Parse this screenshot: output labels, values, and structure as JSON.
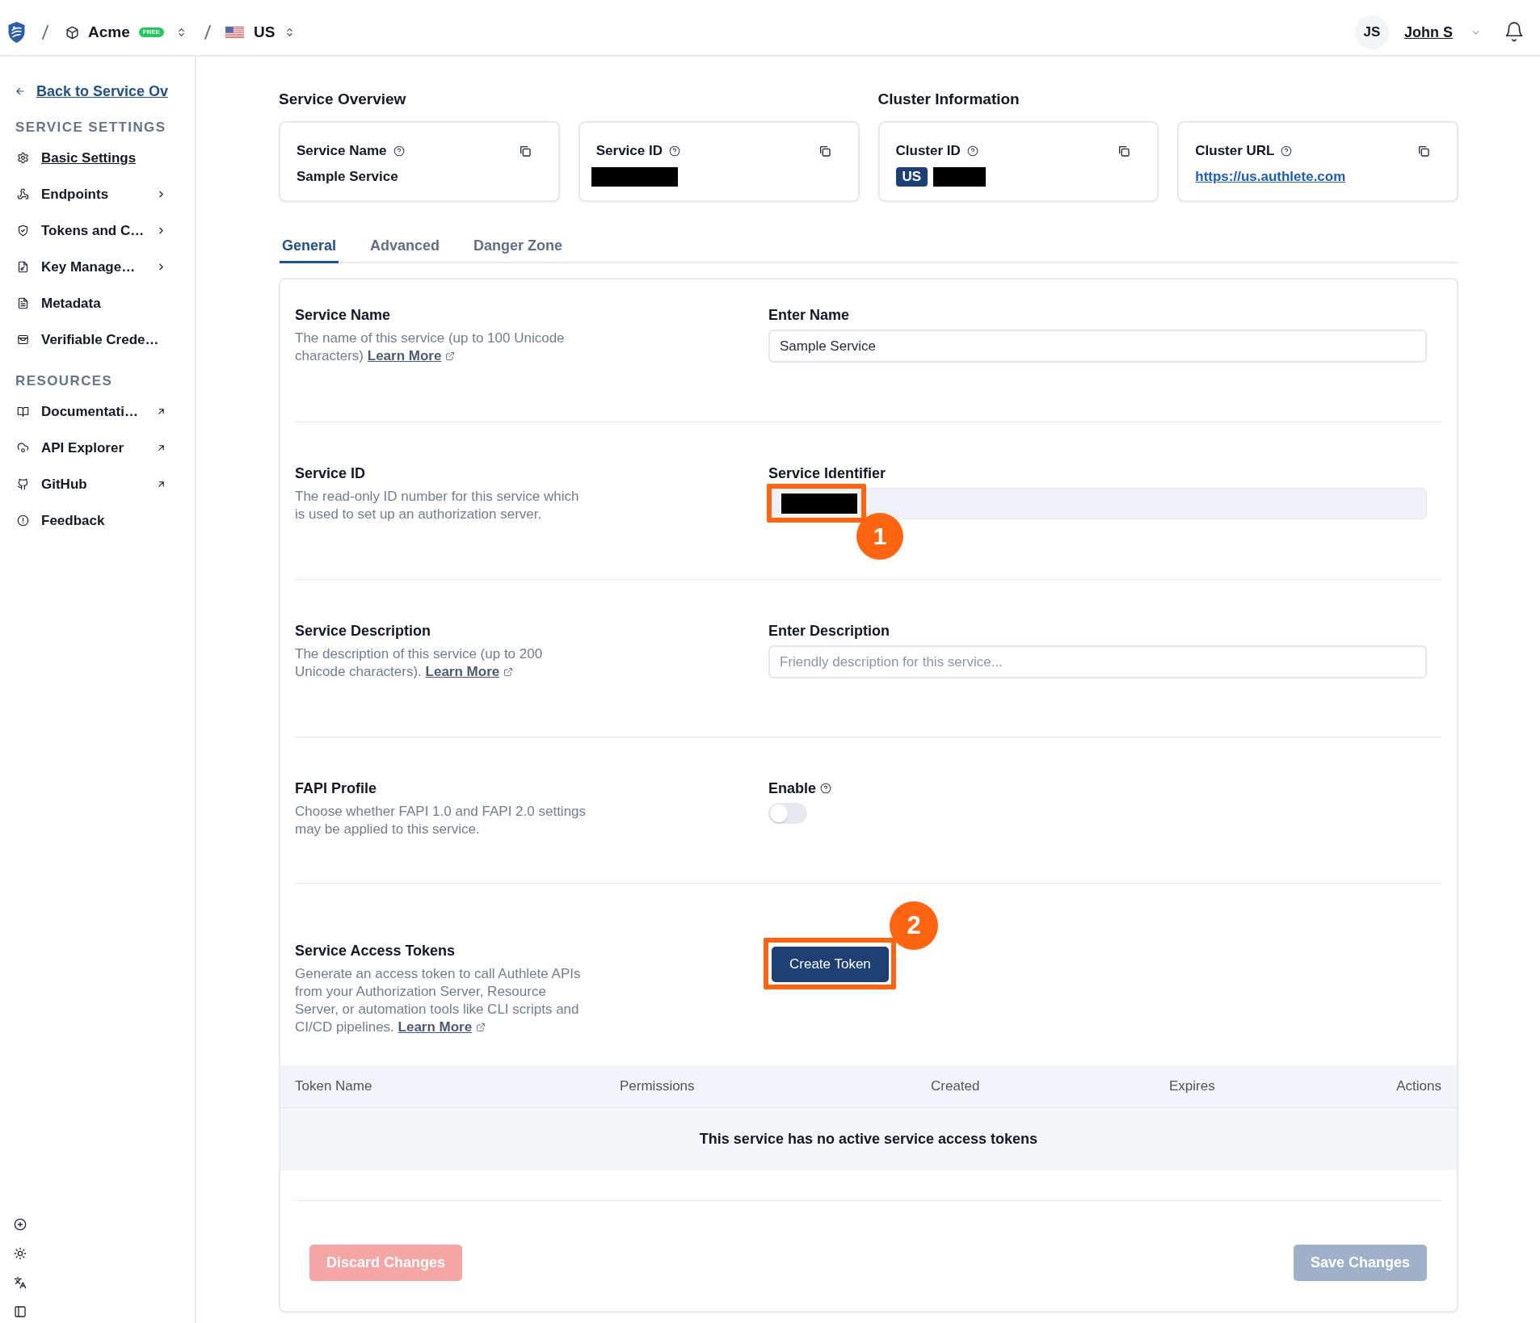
{
  "topbar": {
    "organization": "Acme",
    "plan_badge": "FREE",
    "cluster": "US",
    "user": {
      "initials": "JS",
      "name": "John S"
    }
  },
  "sidebar": {
    "back_link": "Back to Service Ov",
    "groups": [
      {
        "heading": "SERVICE SETTINGS",
        "items": [
          {
            "label": "Basic Settings",
            "kind": "page",
            "selected": true
          },
          {
            "label": "Endpoints",
            "kind": "submenu",
            "selected": false
          },
          {
            "label": "Tokens and C…",
            "kind": "submenu",
            "selected": false
          },
          {
            "label": "Key Manage…",
            "kind": "submenu",
            "selected": false
          },
          {
            "label": "Metadata",
            "kind": "page",
            "selected": false
          },
          {
            "label": "Verifiable Crede…",
            "kind": "page",
            "selected": false
          }
        ]
      },
      {
        "heading": "RESOURCES",
        "items": [
          {
            "label": "Documentati…",
            "kind": "external",
            "selected": false
          },
          {
            "label": "API Explorer",
            "kind": "external",
            "selected": false
          },
          {
            "label": "GitHub",
            "kind": "external",
            "selected": false
          },
          {
            "label": "Feedback",
            "kind": "page",
            "selected": false
          }
        ]
      }
    ]
  },
  "overview": [
    {
      "heading": "Service Overview",
      "cards": [
        {
          "label": "Service Name",
          "value": "Sample Service"
        },
        {
          "label": "Service ID",
          "redacted": true
        }
      ]
    },
    {
      "heading": "Cluster Information",
      "cards": [
        {
          "label": "Cluster ID",
          "badge": "US",
          "redacted": true
        },
        {
          "label": "Cluster URL",
          "link": "https://us.authlete.com"
        }
      ]
    }
  ],
  "tabs": [
    {
      "label": "General",
      "selected": true
    },
    {
      "label": "Advanced",
      "selected": false
    },
    {
      "label": "Danger Zone",
      "selected": false
    }
  ],
  "form": {
    "sections": [
      {
        "kind": "text_input",
        "title": "Service Name",
        "description": "The name of this service (up to 100 Unicode characters)",
        "link": "Learn More",
        "field_label": "Enter Name",
        "value": "Sample Service"
      },
      {
        "kind": "readonly",
        "title": "Service ID",
        "description": "The read-only ID number for this service which is used to set up an authorization server.",
        "field_label": "Service Identifier",
        "redacted": true,
        "callout": "1"
      },
      {
        "kind": "text_input",
        "title": "Service Description",
        "description": "The description of this service (up to 200 Unicode characters).",
        "link": "Learn More",
        "field_label": "Enter Description",
        "placeholder": "Friendly description for this service..."
      },
      {
        "kind": "toggle",
        "title": "FAPI Profile",
        "description": "Choose whether FAPI 1.0 and FAPI 2.0 settings may be applied to this service.",
        "field_label": "Enable",
        "on": false
      },
      {
        "kind": "button",
        "title": "Service Access Tokens",
        "description": "Generate an access token to call Authlete APIs from your Authorization Server, Resource Server, or automation tools like CLI scripts and CI/CD pipelines.",
        "link": "Learn More",
        "button": "Create Token",
        "callout": "2"
      }
    ]
  },
  "tokens_table": {
    "columns": [
      "Token Name",
      "Permissions",
      "Created",
      "Expires",
      "Actions"
    ],
    "empty_message": "This service has no active service access tokens"
  },
  "footer_buttons": [
    {
      "label": "Discard Changes",
      "kind": "discard",
      "disabled": true
    },
    {
      "label": "Save Changes",
      "kind": "save",
      "disabled": true
    }
  ]
}
